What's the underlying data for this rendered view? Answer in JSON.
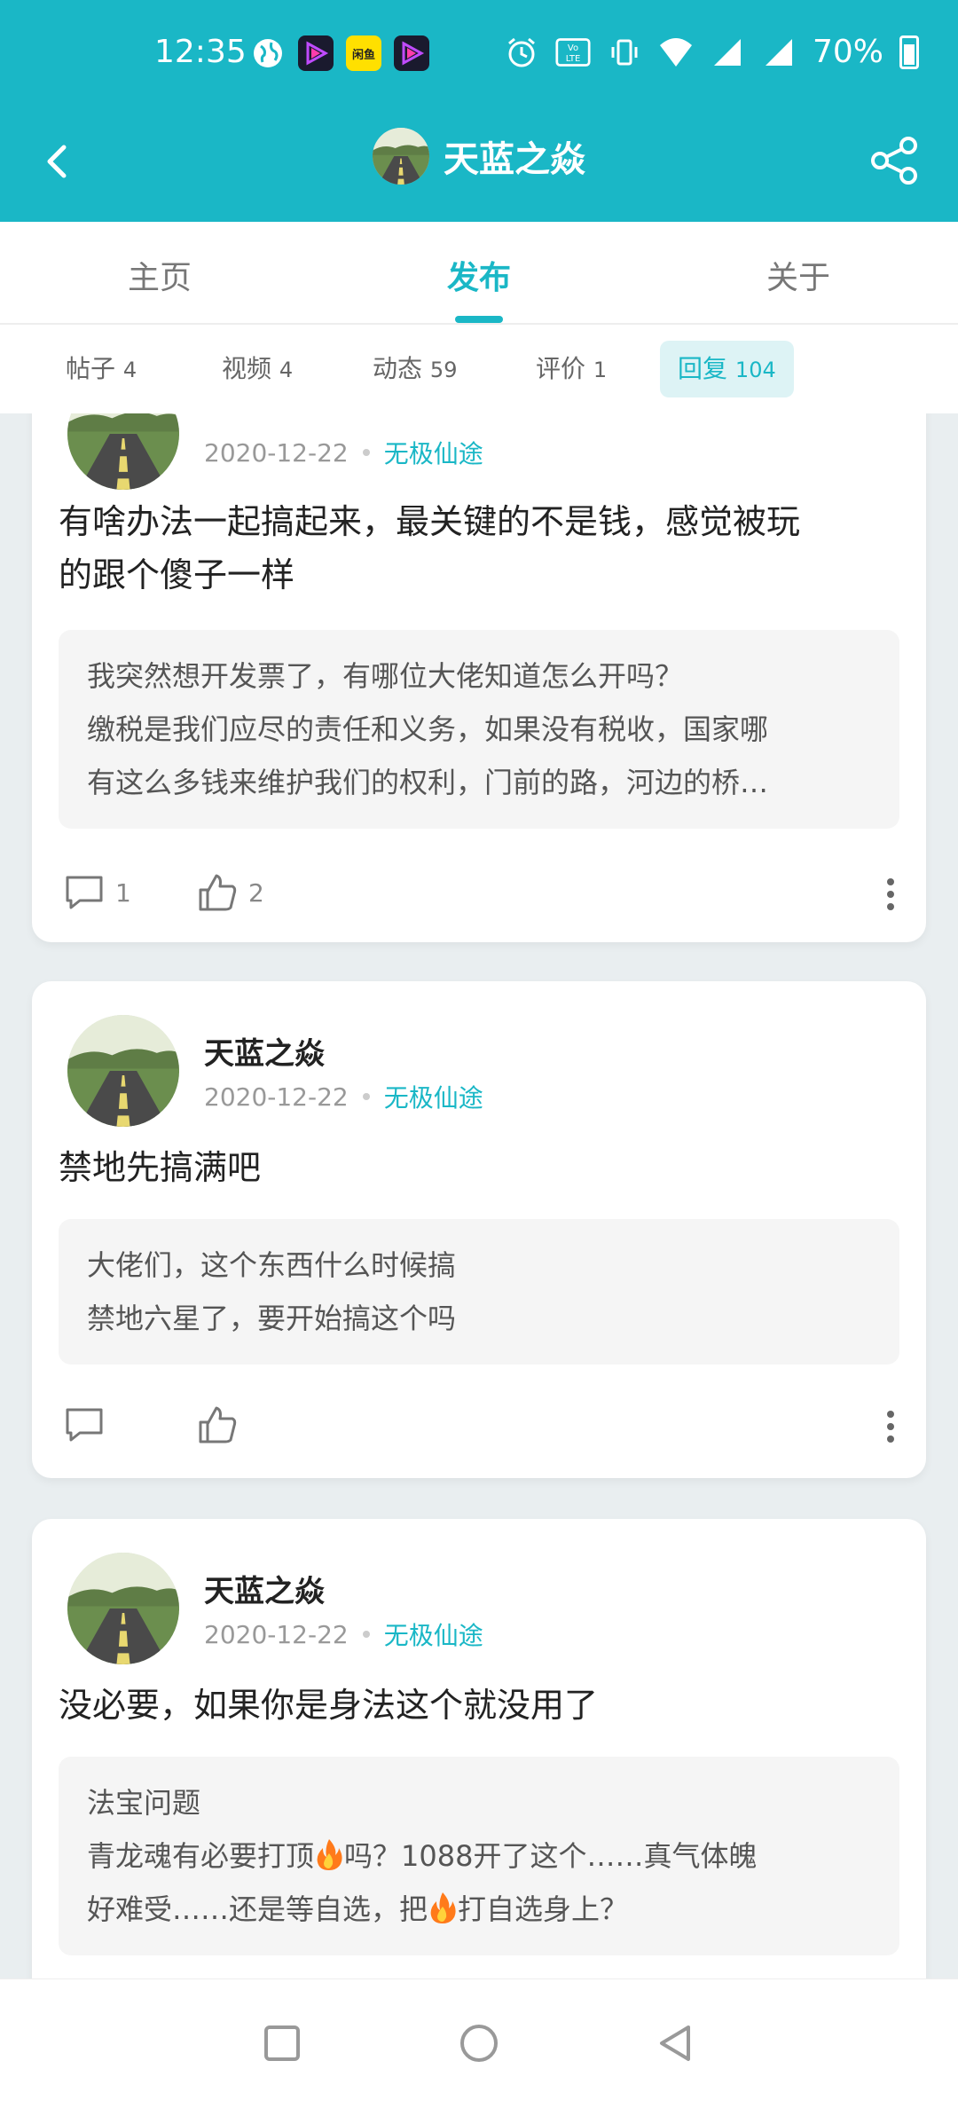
{
  "status_bar": {
    "time": "12:35",
    "apps": [
      {
        "icon": "globe-icon",
        "color": "#ffffff"
      },
      {
        "icon": "video-app-icon",
        "color": "#7b2ff7"
      },
      {
        "icon": "xianyu-app-icon",
        "color": "#ffe000",
        "label": "闲鱼"
      },
      {
        "icon": "video-app-icon",
        "color": "#7b2ff7"
      }
    ],
    "battery": "70%"
  },
  "header": {
    "title": "天蓝之焱",
    "bg_color": "#1ab7c6"
  },
  "main_tabs": [
    {
      "label": "主页",
      "active": false
    },
    {
      "label": "发布",
      "active": true
    },
    {
      "label": "关于",
      "active": false
    }
  ],
  "sub_tabs": [
    {
      "label": "帖子",
      "count": "4",
      "active": false
    },
    {
      "label": "视频",
      "count": "4",
      "active": false
    },
    {
      "label": "动态",
      "count": "59",
      "active": false
    },
    {
      "label": "评价",
      "count": "1",
      "active": false
    },
    {
      "label": "回复",
      "count": "104",
      "active": true
    }
  ],
  "posts": [
    {
      "author": "",
      "date": "2020-12-22",
      "game": "无极仙途",
      "content": [
        "有啥办法一起搞起来，最关键的不是钱，感觉被玩",
        "的跟个傻子一样"
      ],
      "quote": [
        "我突然想开发票了，有哪位大佬知道怎么开吗？",
        "缴税是我们应尽的责任和义务，如果没有税收，国家哪",
        "有这么多钱来维护我们的权利，门前的路，河边的桥…"
      ],
      "comments": "1",
      "likes": "2"
    },
    {
      "author": "天蓝之焱",
      "date": "2020-12-22",
      "game": "无极仙途",
      "content": [
        "禁地先搞满吧"
      ],
      "quote": [
        "大佬们，这个东西什么时候搞",
        "禁地六星了，要开始搞这个吗"
      ],
      "comments": "",
      "likes": ""
    },
    {
      "author": "天蓝之焱",
      "date": "2020-12-22",
      "game": "无极仙途",
      "content": [
        "没必要，如果你是身法这个就没用了"
      ],
      "quote_title": "法宝问题",
      "quote_line1_a": "青龙魂有必要打顶",
      "quote_line1_b": "吗？1088开了这个……真气体魄",
      "quote_line2_a": "好难受……还是等自选，把",
      "quote_line2_b": "打自选身上？"
    }
  ]
}
